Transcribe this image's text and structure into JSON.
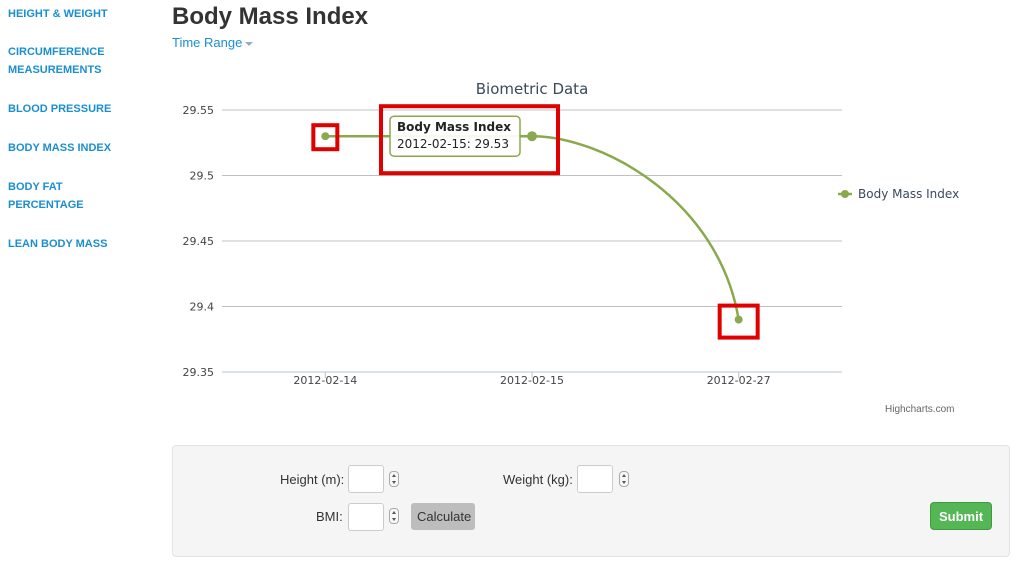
{
  "sidebar": {
    "items": [
      {
        "label": "HEIGHT & WEIGHT"
      },
      {
        "label": "CIRCUMFERENCE MEASUREMENTS"
      },
      {
        "label": "BLOOD PRESSURE"
      },
      {
        "label": "BODY MASS INDEX"
      },
      {
        "label": "BODY FAT PERCENTAGE"
      },
      {
        "label": "LEAN BODY MASS"
      }
    ]
  },
  "header": {
    "title": "Body Mass Index",
    "time_range_label": "Time Range"
  },
  "chart_data": {
    "type": "line",
    "title": "Biometric Data",
    "categories": [
      "2012-02-14",
      "2012-02-15",
      "2012-02-27"
    ],
    "series": [
      {
        "name": "Body Mass Index",
        "values": [
          29.53,
          29.53,
          29.39
        ],
        "color": "#8aa94f"
      }
    ],
    "ylim": [
      29.35,
      29.55
    ],
    "yticks": [
      "29.35",
      "29.4",
      "29.45",
      "29.5",
      "29.55"
    ],
    "grid": true,
    "legend_position": "right",
    "tooltip": {
      "title": "Body Mass Index",
      "text": "2012-02-15: 29.53",
      "point_index": 1
    },
    "credit": "Highcharts.com",
    "highlight_color": "#e00000"
  },
  "form": {
    "height_label": "Height (m):",
    "weight_label": "Weight (kg):",
    "bmi_label": "BMI:",
    "calculate_label": "Calculate",
    "submit_label": "Submit",
    "height_value": "",
    "weight_value": "",
    "bmi_value": ""
  }
}
